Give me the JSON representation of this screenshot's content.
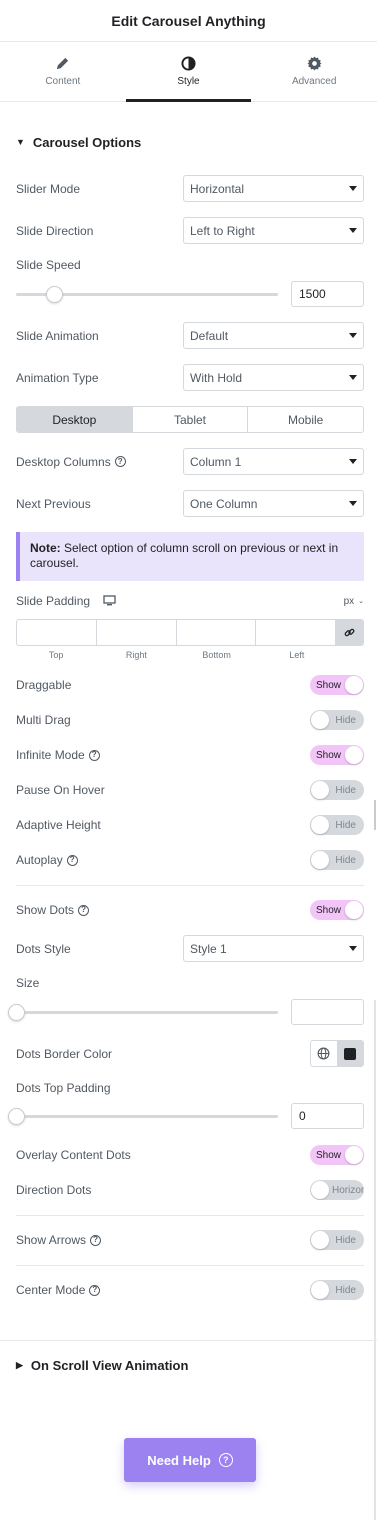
{
  "header": {
    "title": "Edit Carousel Anything"
  },
  "tabs": [
    {
      "label": "Content",
      "icon": "pencil-icon"
    },
    {
      "label": "Style",
      "icon": "contrast-icon"
    },
    {
      "label": "Advanced",
      "icon": "gear-icon"
    }
  ],
  "carousel": {
    "title": "Carousel Options",
    "slider_mode": {
      "label": "Slider Mode",
      "value": "Horizontal"
    },
    "slide_direction": {
      "label": "Slide Direction",
      "value": "Left to Right"
    },
    "slide_speed": {
      "label": "Slide Speed",
      "value": "1500"
    },
    "slide_animation": {
      "label": "Slide Animation",
      "value": "Default"
    },
    "animation_type": {
      "label": "Animation Type",
      "value": "With Hold"
    },
    "devices": [
      "Desktop",
      "Tablet",
      "Mobile"
    ],
    "desktop_columns": {
      "label": "Desktop Columns",
      "value": "Column 1"
    },
    "next_previous": {
      "label": "Next Previous",
      "value": "One Column"
    },
    "note": {
      "bold": "Note:",
      "text": " Select option of column scroll on previous or next in carousel."
    },
    "slide_padding": {
      "label": "Slide Padding",
      "unit": "px",
      "sides": [
        "Top",
        "Right",
        "Bottom",
        "Left"
      ]
    },
    "toggles": [
      {
        "label": "Draggable",
        "state": "Show",
        "on": true,
        "help": false
      },
      {
        "label": "Multi Drag",
        "state": "Hide",
        "on": false,
        "help": false
      },
      {
        "label": "Infinite Mode",
        "state": "Show",
        "on": true,
        "help": true
      },
      {
        "label": "Pause On Hover",
        "state": "Hide",
        "on": false,
        "help": false
      },
      {
        "label": "Adaptive Height",
        "state": "Hide",
        "on": false,
        "help": false
      },
      {
        "label": "Autoplay",
        "state": "Hide",
        "on": false,
        "help": true
      }
    ],
    "show_dots": {
      "label": "Show Dots",
      "state": "Show"
    },
    "dots_style": {
      "label": "Dots Style",
      "value": "Style 1"
    },
    "size": {
      "label": "Size",
      "value": ""
    },
    "dots_border_color": {
      "label": "Dots Border Color"
    },
    "dots_top_padding": {
      "label": "Dots Top Padding",
      "value": "0"
    },
    "overlay_content_dots": {
      "label": "Overlay Content Dots",
      "state": "Show"
    },
    "direction_dots": {
      "label": "Direction Dots",
      "state": "Horizon"
    },
    "show_arrows": {
      "label": "Show Arrows",
      "state": "Hide"
    },
    "center_mode": {
      "label": "Center Mode",
      "state": "Hide"
    }
  },
  "scroll_section": {
    "title": "On Scroll View Animation"
  },
  "help_button": {
    "label": "Need Help"
  }
}
